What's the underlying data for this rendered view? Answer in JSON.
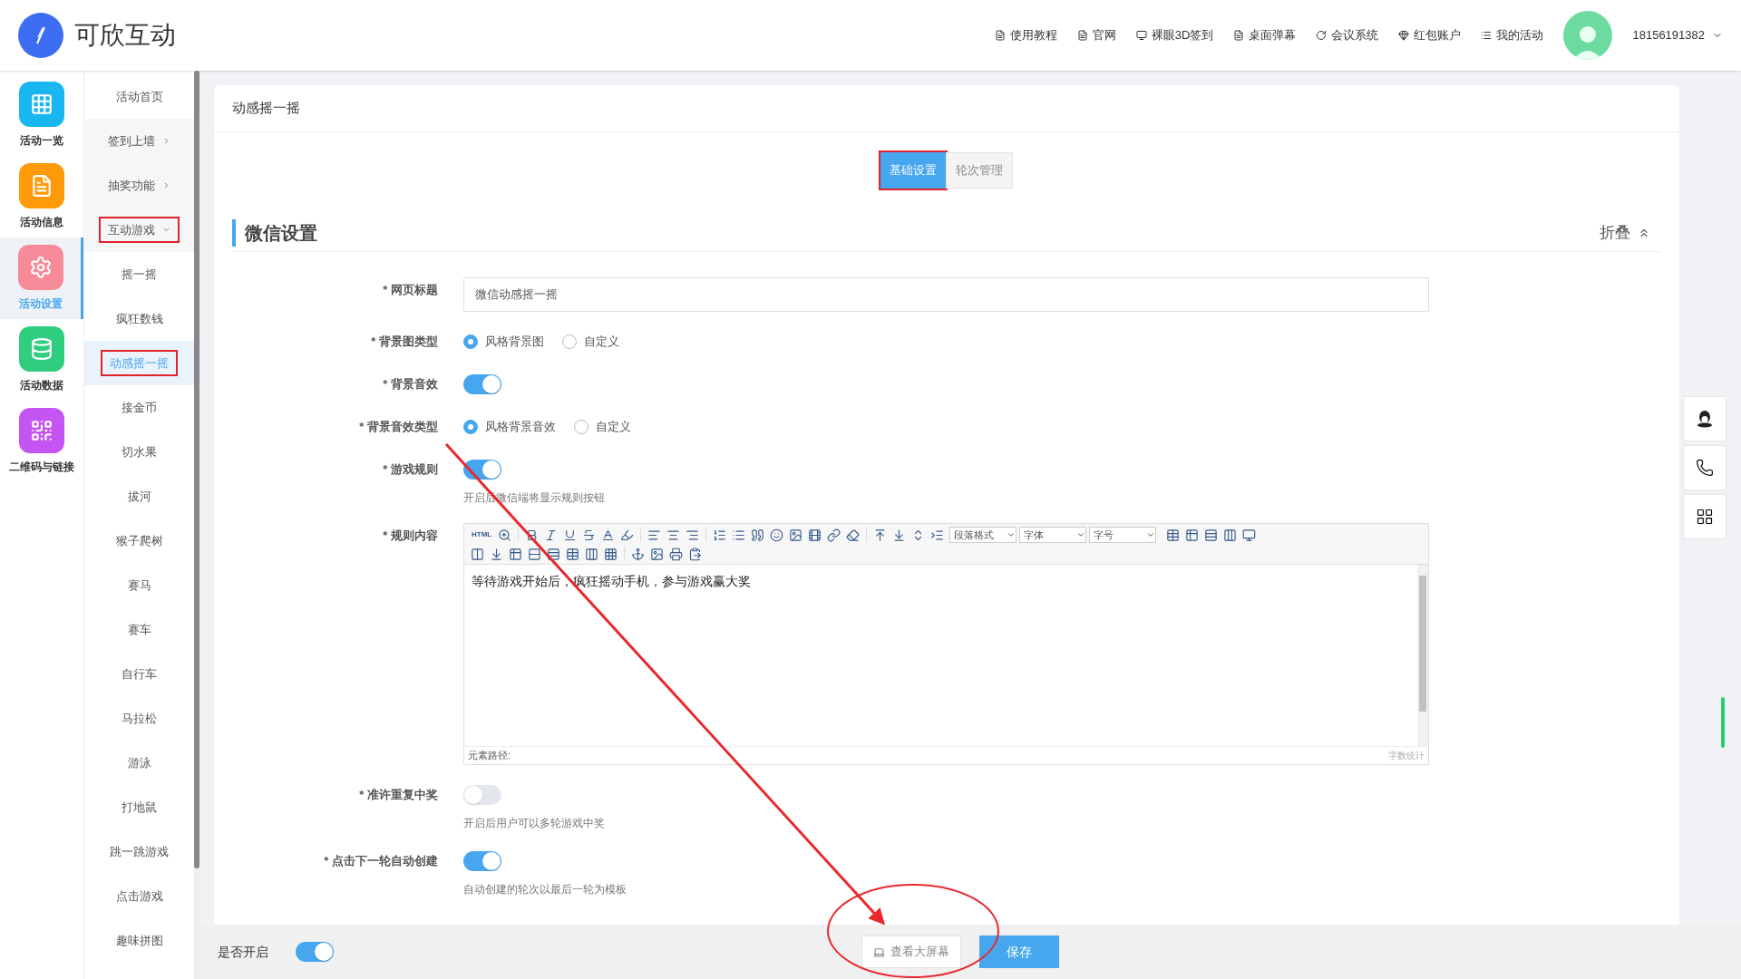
{
  "brand": {
    "name": "可欣互动"
  },
  "top_nav": [
    {
      "label": "使用教程",
      "kind": "file"
    },
    {
      "label": "官网",
      "kind": "file"
    },
    {
      "label": "裸眼3D签到",
      "kind": "screen"
    },
    {
      "label": "桌面弹幕",
      "kind": "file"
    },
    {
      "label": "会议系统",
      "kind": "swirl"
    },
    {
      "label": "红包账户",
      "kind": "gem"
    },
    {
      "label": "我的活动",
      "kind": "list"
    }
  ],
  "user": {
    "phone": "18156191382"
  },
  "side_nav": [
    {
      "label": "活动一览",
      "kind": "grid",
      "color": "#1ab6ef",
      "selected": false
    },
    {
      "label": "活动信息",
      "kind": "doc",
      "color": "#ff9a0a",
      "selected": false
    },
    {
      "label": "活动设置",
      "kind": "gear",
      "color": "#f78a98",
      "selected": true
    },
    {
      "label": "活动数据",
      "kind": "data",
      "color": "#2fce7e",
      "selected": false
    },
    {
      "label": "二维码与链接",
      "kind": "qr",
      "color": "#c455f2",
      "selected": false
    }
  ],
  "sub_nav": [
    {
      "label": "活动首页",
      "kind": "link",
      "selected": false,
      "highlighted": false
    },
    {
      "label": "签到上墙",
      "kind": "group",
      "expanded": false,
      "highlighted": false
    },
    {
      "label": "抽奖功能",
      "kind": "group",
      "expanded": false,
      "highlighted": false
    },
    {
      "label": "互动游戏",
      "kind": "group",
      "expanded": true,
      "highlighted": true,
      "children": [
        {
          "label": "摇一摇",
          "selected": false,
          "highlighted": false
        },
        {
          "label": "疯狂数钱",
          "selected": false,
          "highlighted": false
        },
        {
          "label": "动感摇一摇",
          "selected": true,
          "highlighted": true
        },
        {
          "label": "接金币",
          "selected": false,
          "highlighted": false
        },
        {
          "label": "切水果",
          "selected": false,
          "highlighted": false
        },
        {
          "label": "拔河",
          "selected": false,
          "highlighted": false
        },
        {
          "label": "猴子爬树",
          "selected": false,
          "highlighted": false
        },
        {
          "label": "赛马",
          "selected": false,
          "highlighted": false
        },
        {
          "label": "赛车",
          "selected": false,
          "highlighted": false
        },
        {
          "label": "自行车",
          "selected": false,
          "highlighted": false
        },
        {
          "label": "马拉松",
          "selected": false,
          "highlighted": false
        },
        {
          "label": "游泳",
          "selected": false,
          "highlighted": false
        },
        {
          "label": "打地鼠",
          "selected": false,
          "highlighted": false
        },
        {
          "label": "跳一跳游戏",
          "selected": false,
          "highlighted": false
        },
        {
          "label": "点击游戏",
          "selected": false,
          "highlighted": false
        },
        {
          "label": "趣味拼图",
          "selected": false,
          "highlighted": false
        }
      ]
    }
  ],
  "page": {
    "title": "动感摇一摇"
  },
  "tabs": [
    {
      "label": "基础设置",
      "selected": true,
      "highlighted": true
    },
    {
      "label": "轮次管理",
      "selected": false,
      "highlighted": false
    }
  ],
  "section": {
    "title": "微信设置",
    "collapse": "折叠"
  },
  "form": [
    {
      "kind": "text",
      "label": "* 网页标题",
      "value": "微信动感摇一摇"
    },
    {
      "kind": "radio",
      "label": "* 背景图类型",
      "options": [
        {
          "label": "风格背景图",
          "selected": true
        },
        {
          "label": "自定义",
          "selected": false
        }
      ]
    },
    {
      "kind": "switch",
      "label": "* 背景音效",
      "on": true
    },
    {
      "kind": "radio",
      "label": "* 背景音效类型",
      "options": [
        {
          "label": "风格背景音效",
          "selected": true
        },
        {
          "label": "自定义",
          "selected": false
        }
      ]
    },
    {
      "kind": "switch",
      "label": "* 游戏规则",
      "on": true,
      "help": "开启后微信端将显示规则按钮"
    },
    {
      "kind": "editor",
      "label": "* 规则内容",
      "html_button": "HTML",
      "dropdowns": [
        "段落格式",
        "字体",
        "字号"
      ],
      "content": "等待游戏开始后，疯狂摇动手机，参与游戏赢大奖",
      "path_label": "元素路径:",
      "word_count": "字数统计"
    },
    {
      "kind": "switch",
      "label": "* 准许重复中奖",
      "on": false,
      "help": "开启后用户可以多轮游戏中奖"
    },
    {
      "kind": "switch",
      "label": "* 点击下一轮自动创建",
      "on": true,
      "help": "自动创建的轮次以最后一轮为模板"
    }
  ],
  "bottom_bar": {
    "enable_label": "是否开启",
    "enabled": true,
    "buttons": [
      {
        "kind": "preview",
        "label": "查看大屏幕"
      },
      {
        "kind": "save",
        "label": "保存"
      }
    ]
  },
  "annotations": {
    "arrow": true,
    "ellipse": true
  }
}
